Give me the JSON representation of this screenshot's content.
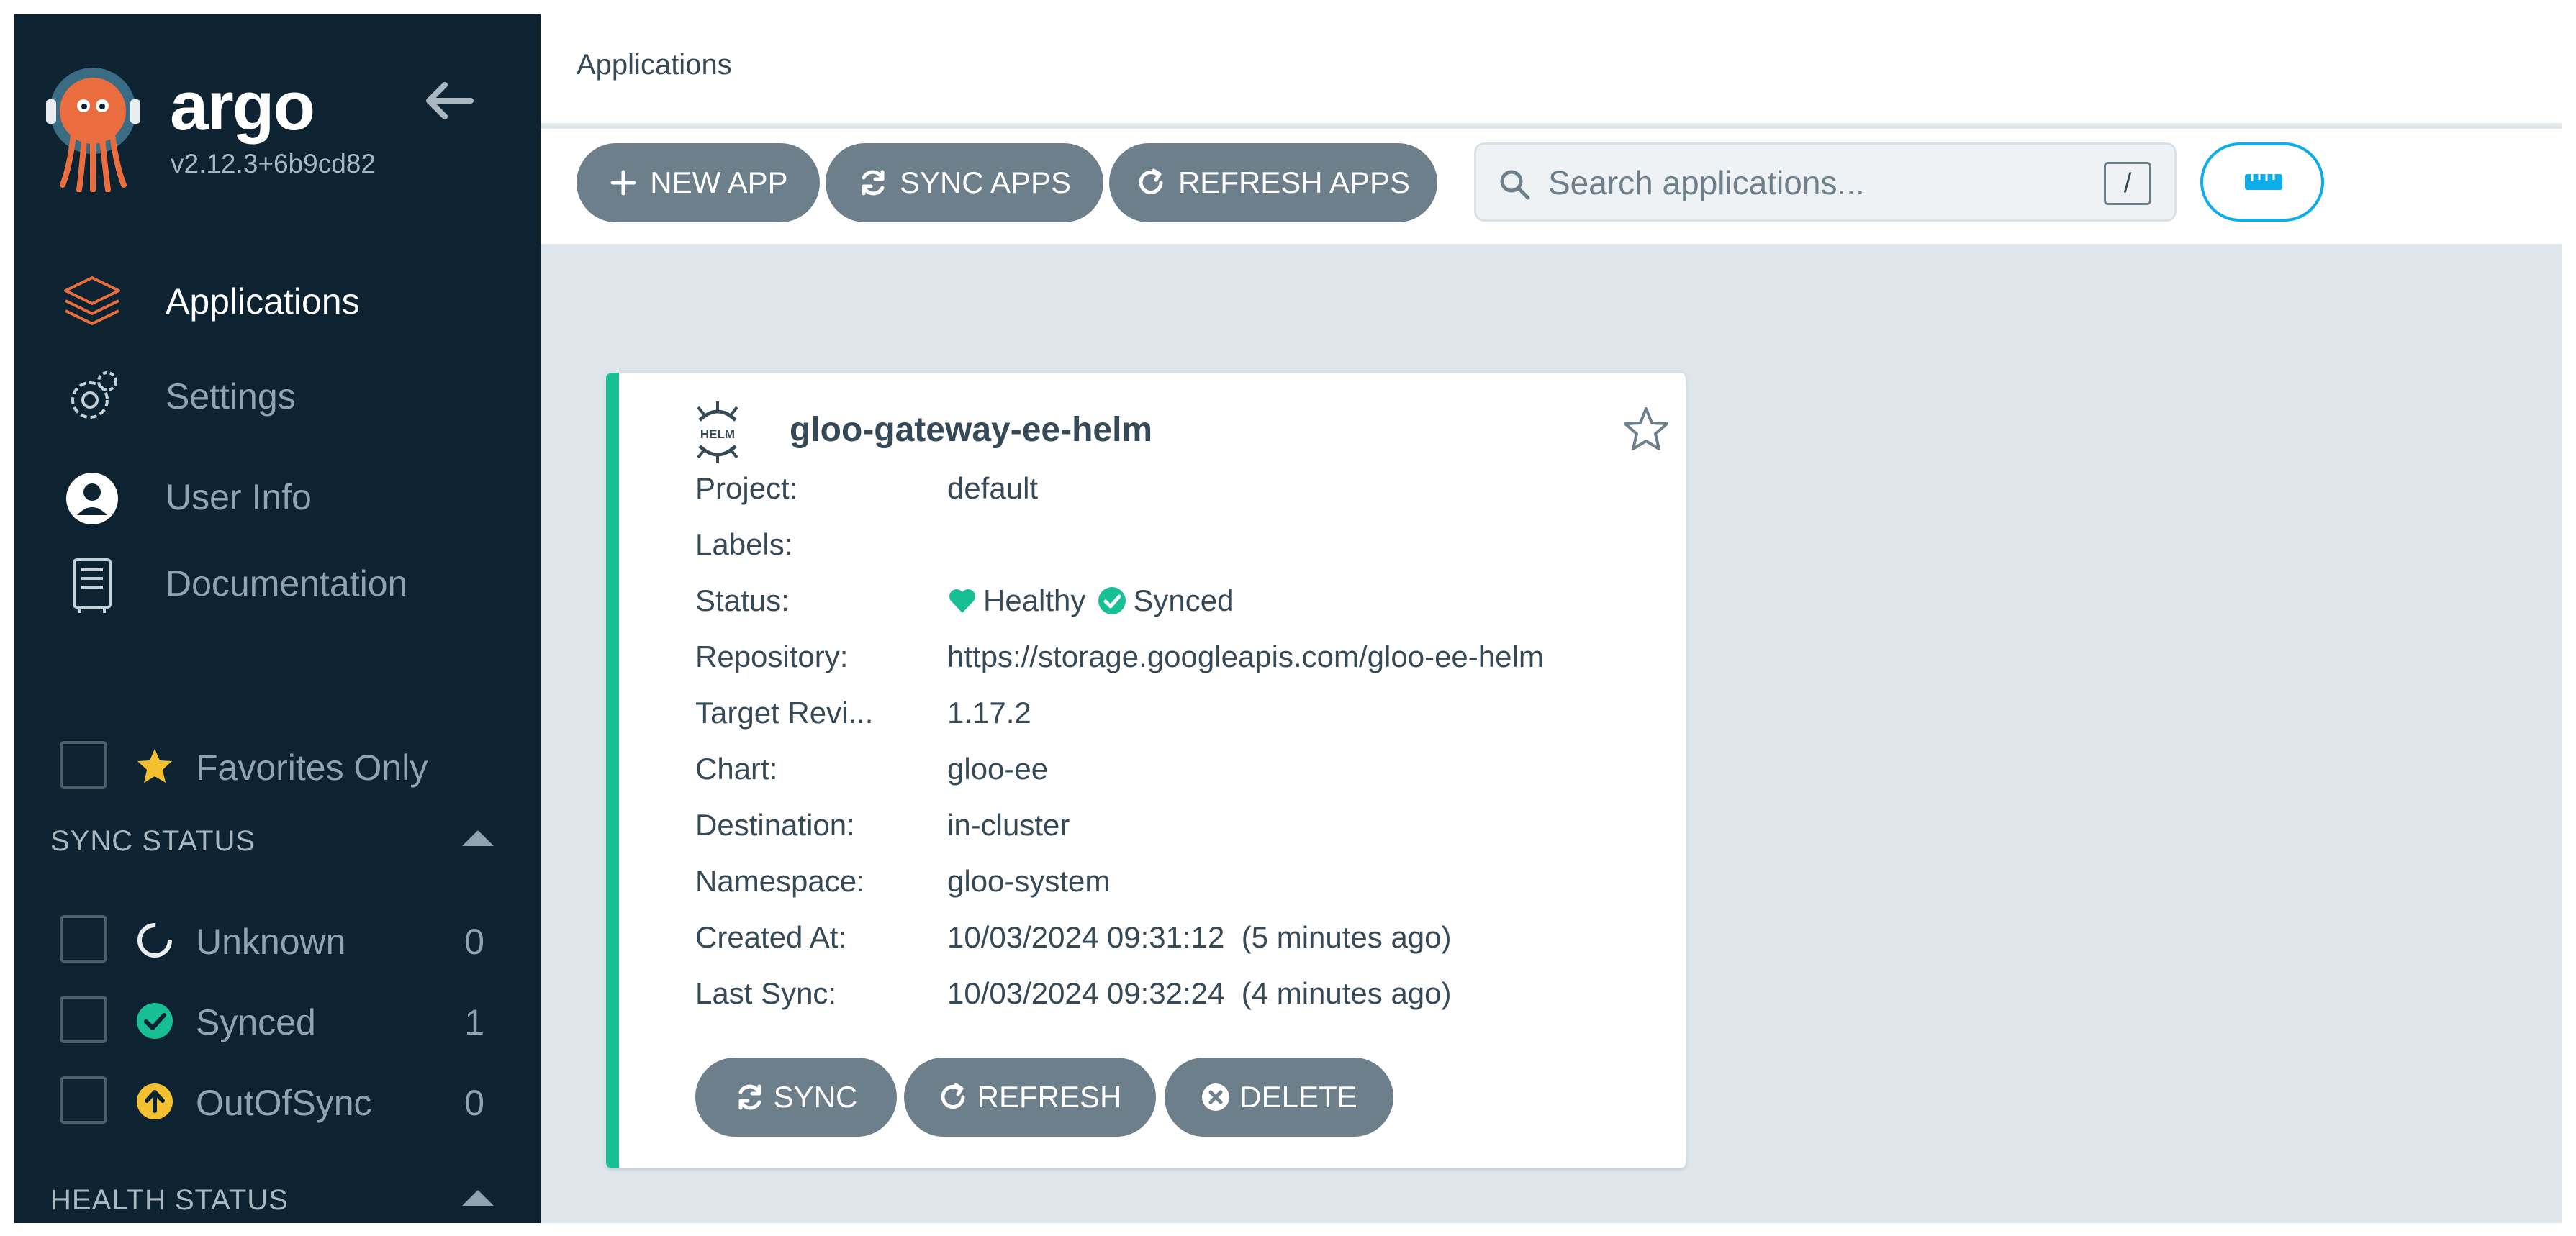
{
  "sidebar": {
    "brand": "argo",
    "version": "v2.12.3+6b9cd82",
    "nav": [
      {
        "label": "Applications",
        "icon": "layers-icon",
        "active": true
      },
      {
        "label": "Settings",
        "icon": "gear-icon",
        "active": false
      },
      {
        "label": "User Info",
        "icon": "user-icon",
        "active": false
      },
      {
        "label": "Documentation",
        "icon": "document-icon",
        "active": false
      }
    ],
    "favorites_label": "Favorites Only",
    "sync_status_header": "SYNC STATUS",
    "sync_filters": [
      {
        "label": "Unknown",
        "count": "0",
        "icon": "unknown-circle-icon"
      },
      {
        "label": "Synced",
        "count": "1",
        "icon": "synced-check-icon",
        "color": "#18be94"
      },
      {
        "label": "OutOfSync",
        "count": "0",
        "icon": "out-of-sync-arrow-icon",
        "color": "#f4c030"
      }
    ],
    "health_status_header": "HEALTH STATUS"
  },
  "header": {
    "breadcrumb": "Applications"
  },
  "toolbar": {
    "new_app": "NEW APP",
    "sync_apps": "SYNC APPS",
    "refresh_apps": "REFRESH APPS",
    "search_placeholder": "Search applications...",
    "search_shortcut": "/"
  },
  "app_card": {
    "title": "gloo-gateway-ee-helm",
    "fields": [
      {
        "key": "Project:",
        "value": "default"
      },
      {
        "key": "Labels:",
        "value": ""
      },
      {
        "key": "Status:",
        "value": ""
      },
      {
        "key": "Repository:",
        "value": "https://storage.googleapis.com/gloo-ee-helm"
      },
      {
        "key": "Target Revi...",
        "value": "1.17.2"
      },
      {
        "key": "Chart:",
        "value": "gloo-ee"
      },
      {
        "key": "Destination:",
        "value": "in-cluster"
      },
      {
        "key": "Namespace:",
        "value": "gloo-system"
      },
      {
        "key": "Created At:",
        "value": "10/03/2024 09:31:12  (5 minutes ago)"
      },
      {
        "key": "Last Sync:",
        "value": "10/03/2024 09:32:24  (4 minutes ago)"
      }
    ],
    "health": "Healthy",
    "sync": "Synced",
    "sync_button": "SYNC",
    "refresh_button": "REFRESH",
    "delete_button": "DELETE"
  },
  "colors": {
    "sidebar_bg": "#0e2331",
    "accent_green": "#18be94",
    "button_gray": "#6d7f8b",
    "accent_teal": "#0dadea",
    "orange_accent": "#e96d3e",
    "star_yellow": "#f4c030"
  }
}
